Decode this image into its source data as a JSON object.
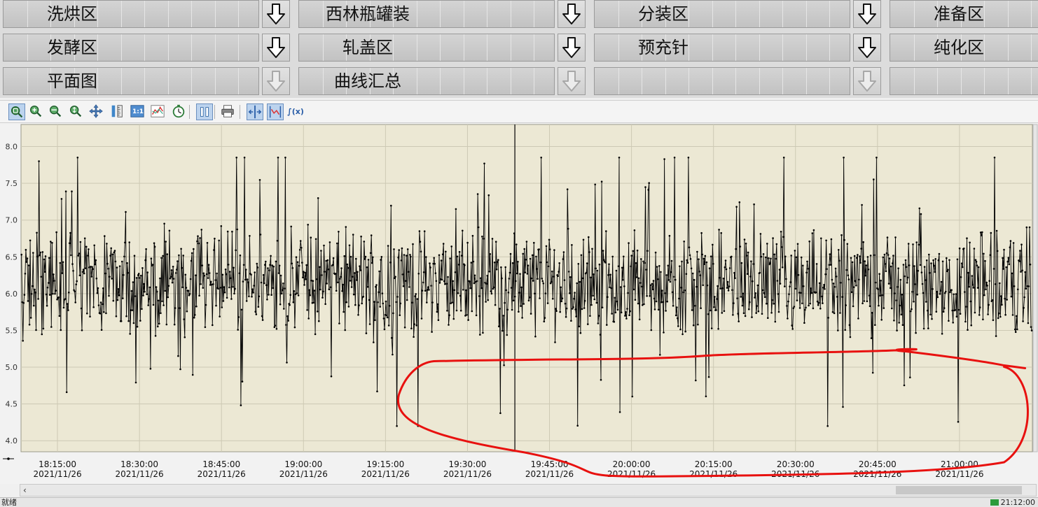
{
  "nav": {
    "rows": [
      [
        {
          "label": "洗烘区",
          "arrow": "active"
        },
        {
          "label": "西林瓶罐装",
          "arrow": "active"
        },
        {
          "label": "分装区",
          "arrow": "active"
        },
        {
          "label": "准备区"
        }
      ],
      [
        {
          "label": "发酵区",
          "arrow": "active"
        },
        {
          "label": "轧盖区",
          "arrow": "active"
        },
        {
          "label": "预充针",
          "arrow": "active"
        },
        {
          "label": "纯化区"
        }
      ],
      [
        {
          "label": "平面图",
          "arrow": "disabled"
        },
        {
          "label": "曲线汇总",
          "arrow": "disabled"
        },
        {
          "label": "",
          "arrow": "disabled"
        },
        {
          "label": ""
        }
      ]
    ]
  },
  "toolbar": {
    "buttons": [
      {
        "name": "zoom-fit-icon",
        "active": true
      },
      {
        "name": "zoom-in-icon"
      },
      {
        "name": "zoom-out-icon"
      },
      {
        "name": "zoom-vertical-icon"
      },
      {
        "name": "pan-icon"
      },
      {
        "name": "ruler-icon"
      },
      {
        "name": "one-to-one-icon",
        "text": "1:1"
      },
      {
        "name": "trend-icon"
      },
      {
        "name": "timer-icon"
      },
      {
        "name": "pause-icon",
        "active": true
      },
      {
        "name": "print-icon"
      },
      {
        "name": "cursor-line-icon",
        "active": true
      },
      {
        "name": "cursor-point-icon",
        "active": true
      },
      {
        "name": "function-icon",
        "text": "∫(x)"
      }
    ]
  },
  "chart_data": {
    "type": "line",
    "title": "",
    "xlabel": "",
    "ylabel": "",
    "ylim": [
      3.85,
      8.3
    ],
    "yticks": [
      "8.0",
      "7.5",
      "7.0",
      "6.5",
      "6.0",
      "5.5",
      "5.0",
      "4.5",
      "4.0"
    ],
    "ytick_values": [
      8.0,
      7.5,
      7.0,
      6.5,
      6.0,
      5.5,
      5.0,
      4.5,
      4.0
    ],
    "x_range": [
      "18:08:20",
      "21:13:20"
    ],
    "xticks": [
      {
        "time": "18:15:00",
        "date": "2021/11/26"
      },
      {
        "time": "18:30:00",
        "date": "2021/11/26"
      },
      {
        "time": "18:45:00",
        "date": "2021/11/26"
      },
      {
        "time": "19:00:00",
        "date": "2021/11/26"
      },
      {
        "time": "19:15:00",
        "date": "2021/11/26"
      },
      {
        "time": "19:30:00",
        "date": "2021/11/26"
      },
      {
        "time": "19:45:00",
        "date": "2021/11/26"
      },
      {
        "time": "20:00:00",
        "date": "2021/11/26"
      },
      {
        "time": "20:15:00",
        "date": "2021/11/26"
      },
      {
        "time": "20:30:00",
        "date": "2021/11/26"
      },
      {
        "time": "20:45:00",
        "date": "2021/11/26"
      },
      {
        "time": "21:00:00",
        "date": "2021/11/26"
      }
    ],
    "cursor_time": "19:38:40",
    "grid": true,
    "series": [
      {
        "color": "#000000",
        "marker": "dot",
        "mean": 6.15,
        "spread": 0.55,
        "min": 4.2,
        "max": 7.85,
        "interval_seconds": 8,
        "note_points": "dense noisy signal"
      }
    ],
    "annotation": {
      "shape": "freehand-loop",
      "color": "#e8110f",
      "from": "19:20:00",
      "to": "21:12:00",
      "y_top": 5.1,
      "y_bottom": 3.65
    }
  },
  "colors": {
    "plot_bg": "#ece8d4",
    "grid": "#cdc9b4",
    "annotation": "#e8110f",
    "line": "#000000"
  },
  "status": {
    "left": "就绪",
    "time": "21:12:00"
  }
}
